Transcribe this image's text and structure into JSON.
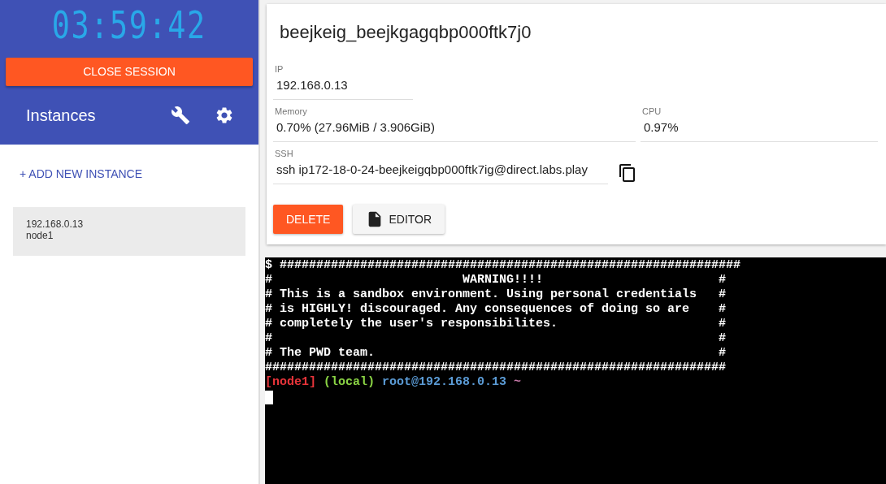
{
  "sidebar": {
    "timer": "03:59:42",
    "close_button": "CLOSE SESSION",
    "title": "Instances",
    "add_button": "+ ADD NEW INSTANCE",
    "instances": [
      {
        "ip": "192.168.0.13",
        "name": "node1",
        "selected": true
      }
    ]
  },
  "instance": {
    "title": "beejkeig_beejkgagqbp000ftk7j0",
    "ip": {
      "label": "IP",
      "value": "192.168.0.13"
    },
    "memory": {
      "label": "Memory",
      "value": "0.70% (27.96MiB / 3.906GiB)"
    },
    "cpu": {
      "label": "CPU",
      "value": "0.97%"
    },
    "ssh": {
      "label": "SSH",
      "value": "ssh ip172-18-0-24-beejkeigqbp000ftk7ig@direct.labs.play"
    },
    "buttons": [
      {
        "label": "DELETE",
        "kind": "danger"
      },
      {
        "label": "EDITOR",
        "kind": "file"
      }
    ]
  },
  "terminal": {
    "lines": [
      "$ ###############################################################",
      "#                          WARNING!!!!                        #",
      "# This is a sandbox environment. Using personal credentials   #",
      "# is HIGHLY! discouraged. Any consequences of doing so are    #",
      "# completely the user's responsibilites.                      #",
      "#                                                             #",
      "# The PWD team.                                               #",
      "###############################################################"
    ],
    "prompt": [
      {
        "text": "[node1]",
        "color": "#e8343a"
      },
      {
        "text": "(local)",
        "color": "#8ad344"
      },
      {
        "text": "root@192.168.0.13",
        "color": "#5b9bd5"
      },
      {
        "text": "~",
        "color": "#c678a8"
      }
    ]
  }
}
